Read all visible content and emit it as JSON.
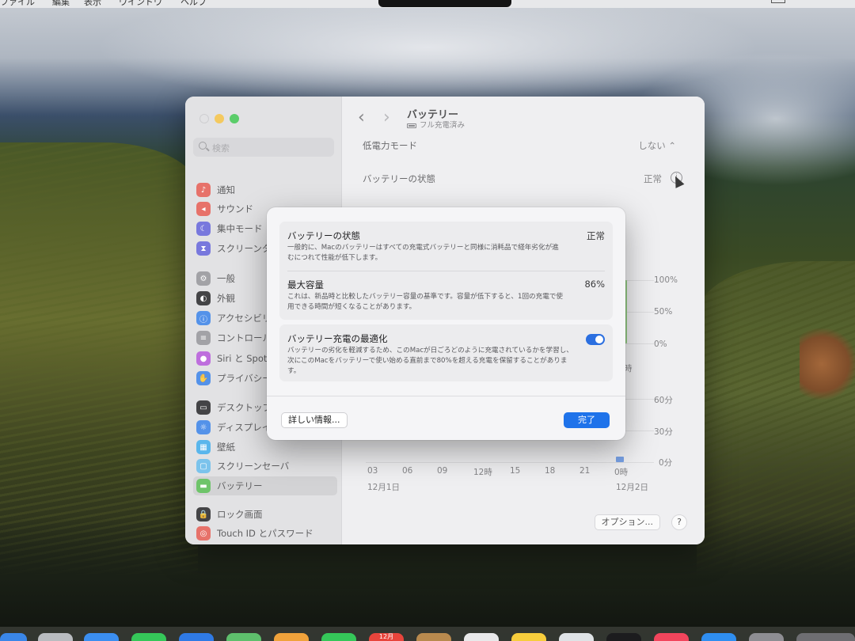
{
  "menubar": {
    "items": [
      "ファイル",
      "編集",
      "表示",
      "ウインドウ",
      "ヘルプ"
    ]
  },
  "window": {
    "title": "バッテリー",
    "subtitle": "フル充電済み"
  },
  "sidebar": {
    "search_placeholder": "検索",
    "items": [
      {
        "label": "通知",
        "icon": "bell-icon",
        "color": "#e2534a"
      },
      {
        "label": "サウンド",
        "icon": "speaker-icon",
        "color": "#e2534a"
      },
      {
        "label": "集中モード",
        "icon": "moon-icon",
        "color": "#5b5bd6"
      },
      {
        "label": "スクリーンタイム",
        "icon": "hourglass-icon",
        "color": "#5b5bd6"
      },
      {
        "label": "一般",
        "icon": "gear-icon",
        "color": "#8e8e93"
      },
      {
        "label": "外観",
        "icon": "appearance-icon",
        "color": "#1c1c1e"
      },
      {
        "label": "アクセシビリティ",
        "icon": "accessibility-icon",
        "color": "#2f7ae5"
      },
      {
        "label": "コントロールセンター",
        "icon": "control-center-icon",
        "color": "#8e8e93"
      },
      {
        "label": "Siri と Spotlight",
        "icon": "siri-icon",
        "color": "#b04fd6"
      },
      {
        "label": "プライバシーとセキュリティ",
        "icon": "hand-icon",
        "color": "#2f7ae5"
      },
      {
        "label": "デスクトップとDock",
        "icon": "dock-icon",
        "color": "#1c1c1e"
      },
      {
        "label": "ディスプレイ",
        "icon": "sun-icon",
        "color": "#2f7ae5"
      },
      {
        "label": "壁紙",
        "icon": "wallpaper-icon",
        "color": "#36a6e8"
      },
      {
        "label": "スクリーンセーバ",
        "icon": "screensaver-icon",
        "color": "#5fb6e8"
      },
      {
        "label": "バッテリー",
        "icon": "battery-icon",
        "color": "#4fb84a"
      },
      {
        "label": "ロック画面",
        "icon": "lock-icon",
        "color": "#1c1c1e"
      },
      {
        "label": "Touch ID とパスワード",
        "icon": "fingerprint-icon",
        "color": "#e2534a"
      }
    ]
  },
  "settings": {
    "low_power_label": "低電力モード",
    "low_power_value": "しない",
    "health_label": "バッテリーの状態",
    "health_value": "正常",
    "level_axis": [
      "100%",
      "50%",
      "0%"
    ],
    "usage_axis": [
      "60分",
      "30分",
      "0分"
    ],
    "time_axis": [
      "03",
      "06",
      "09",
      "12時",
      "15",
      "18",
      "21",
      "0時"
    ],
    "level_axis_partial_label": "時",
    "date_labels": [
      "12月1日",
      "12月2日"
    ],
    "options_button": "オプション...",
    "help_button": "?"
  },
  "sheet": {
    "health": {
      "title": "バッテリーの状態",
      "value": "正常",
      "description": "一般的に、Macのバッテリーはすべての充電式バッテリーと同様に消耗品で経年劣化が進むにつれて性能が低下します。"
    },
    "capacity": {
      "title": "最大容量",
      "value": "86%",
      "description": "これは、新品時と比較したバッテリー容量の基準です。容量が低下すると、1回の充電で使用できる時間が短くなることがあります。"
    },
    "optimized": {
      "title": "バッテリー充電の最適化",
      "enabled": true,
      "description": "バッテリーの劣化を軽減するため、このMacが日ごろどのように充電されているかを学習し、次にこのMacをバッテリーで使い始める直前まで80%を超える充電を保留することがあります。"
    },
    "more_info_button": "詳しい情報...",
    "done_button": "完了"
  },
  "colors": {
    "accent": "#1f73ea",
    "close": "#e0e0e2",
    "minimize": "#f2bd3c",
    "zoom": "#37c24a"
  },
  "dock": {
    "calendar_label": "12月"
  }
}
